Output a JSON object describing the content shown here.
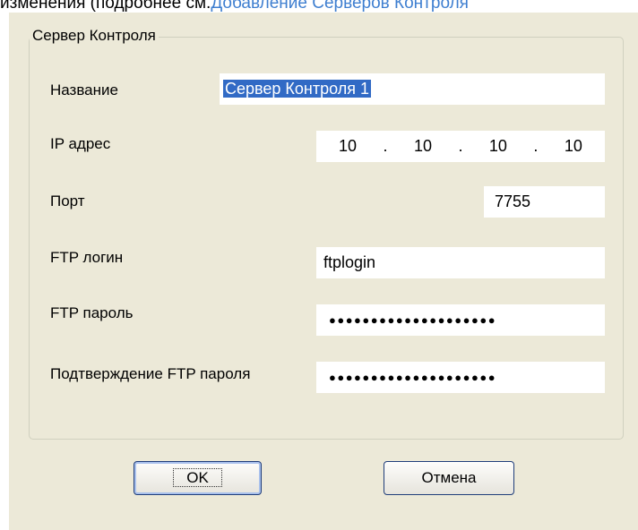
{
  "doc": {
    "text_prefix": "изменения (подробнее см.",
    "link_text": "Добавление Серверов Контроля"
  },
  "dialog": {
    "group_title": "Сервер Контроля",
    "fields": {
      "name": {
        "label": "Название",
        "value": "Сервер Контроля 1"
      },
      "ip": {
        "label": "IP адрес",
        "octets": [
          "10",
          "10",
          "10",
          "10"
        ],
        "separator": "."
      },
      "port": {
        "label": "Порт",
        "value": "7755"
      },
      "ftp_login": {
        "label": "FTP логин",
        "value": "ftplogin"
      },
      "ftp_password": {
        "label": "FTP пароль",
        "masked_value": "●●●●●●●●●●●●●●●●●●●●"
      },
      "ftp_password_confirm": {
        "label": "Подтверждение FTP пароля",
        "masked_value": "●●●●●●●●●●●●●●●●●●●●"
      }
    },
    "buttons": {
      "ok": "OK",
      "cancel": "Отмена"
    }
  }
}
